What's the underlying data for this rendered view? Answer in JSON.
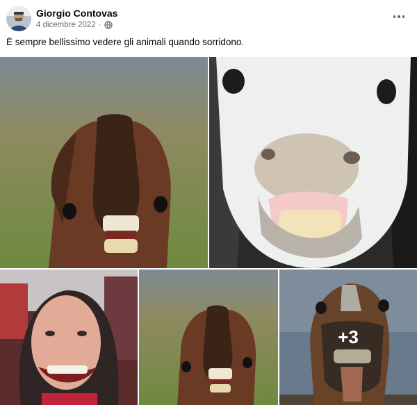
{
  "post": {
    "author": "Giorgio Contovas",
    "date": "4 dicembre 2022",
    "separator": "·",
    "privacy_icon": "globe-icon",
    "more_icon": "more-options-icon",
    "caption": "È sempre bellissimo vedere gli animali quando sorridono."
  },
  "photos": {
    "more_count_label": "+3"
  },
  "colors": {
    "meta_text": "#65676b",
    "text": "#050505"
  }
}
